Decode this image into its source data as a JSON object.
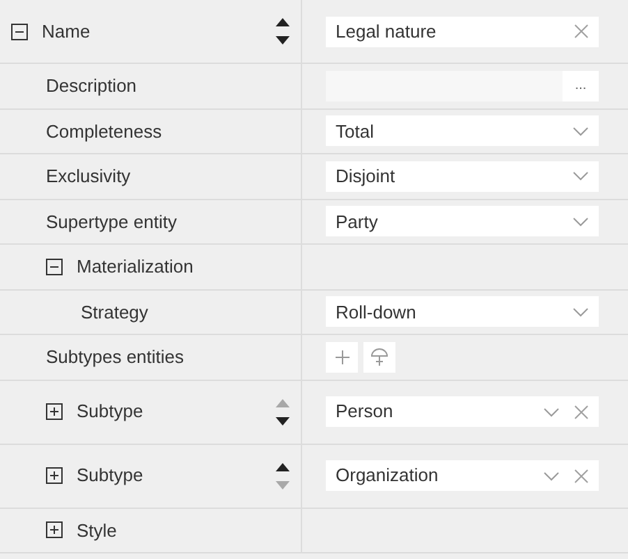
{
  "properties": [
    {
      "label": "Name",
      "expanded": true,
      "move": {
        "up_enabled": true,
        "down_enabled": true
      },
      "value": {
        "kind": "text",
        "text": "Legal nature"
      },
      "children": [
        {
          "label": "Description",
          "value": {
            "kind": "dialog",
            "button": "..."
          }
        },
        {
          "label": "Completeness",
          "value": {
            "kind": "select",
            "text": "Total"
          }
        },
        {
          "label": "Exclusivity",
          "value": {
            "kind": "select",
            "text": "Disjoint"
          }
        },
        {
          "label": "Supertype entity",
          "value": {
            "kind": "select",
            "text": "Party"
          }
        },
        {
          "label": "Materialization",
          "expanded": true,
          "children": [
            {
              "label": "Strategy",
              "value": {
                "kind": "select",
                "text": "Roll-down"
              }
            }
          ]
        },
        {
          "label": "Subtypes entities",
          "value": {
            "kind": "actions"
          }
        },
        {
          "label": "Subtype",
          "expanded": false,
          "move": {
            "up_enabled": false,
            "down_enabled": true
          },
          "value": {
            "kind": "select_clear",
            "text": "Person"
          }
        },
        {
          "label": "Subtype",
          "expanded": false,
          "move": {
            "up_enabled": true,
            "down_enabled": false
          },
          "value": {
            "kind": "select_clear",
            "text": "Organization"
          }
        },
        {
          "label": "Style",
          "expanded": false
        }
      ]
    }
  ]
}
